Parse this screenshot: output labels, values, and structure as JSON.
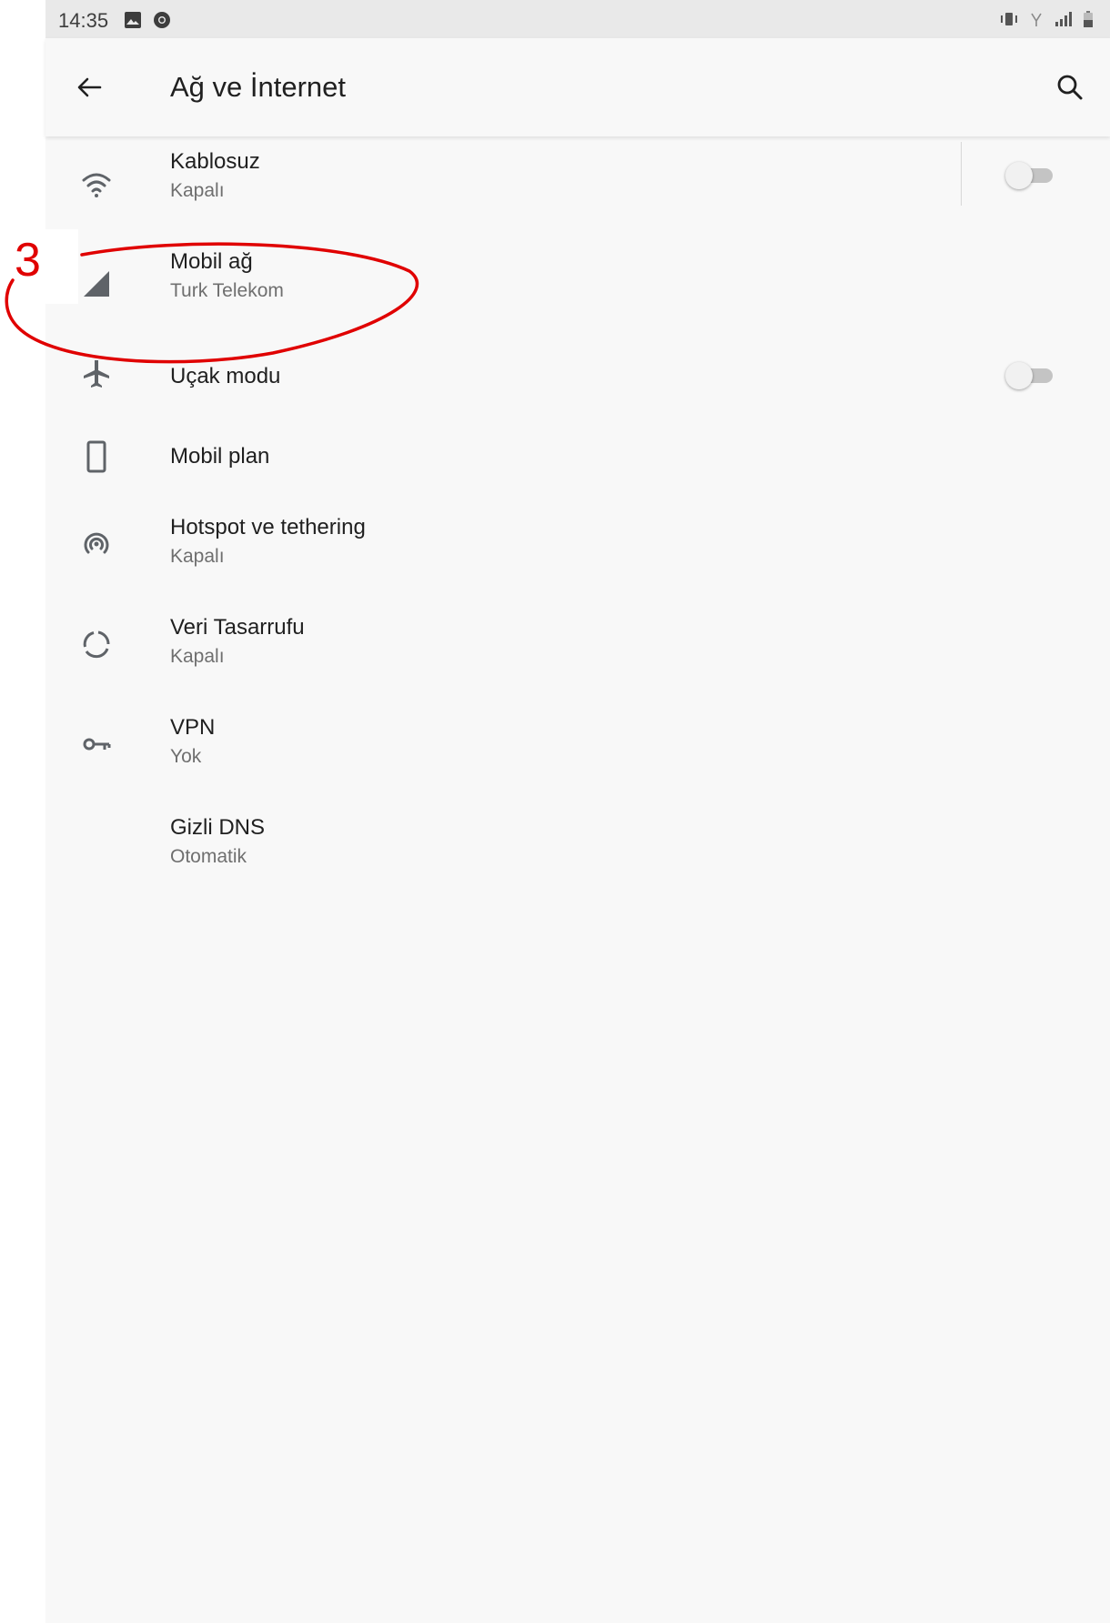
{
  "status_bar": {
    "time": "14:35",
    "left_icons": [
      "image-icon",
      "chrome-icon"
    ],
    "right_icons": [
      "vibrate-icon",
      "wifi-calling-icon",
      "signal-icon",
      "battery-icon"
    ]
  },
  "app_bar": {
    "title": "Ağ ve İnternet",
    "back_icon": "arrow-back-icon",
    "search_icon": "search-icon"
  },
  "items": [
    {
      "id": "wifi",
      "title": "Kablosuz",
      "subtitle": "Kapalı",
      "icon": "wifi-icon",
      "toggle": false
    },
    {
      "id": "mobile",
      "title": "Mobil ağ",
      "subtitle": "Turk Telekom",
      "icon": "cellular-signal-icon"
    },
    {
      "id": "airplane",
      "title": "Uçak modu",
      "subtitle": "",
      "icon": "airplane-icon",
      "toggle": false
    },
    {
      "id": "mobile-plan",
      "title": "Mobil plan",
      "subtitle": "",
      "icon": "phone-icon"
    },
    {
      "id": "hotspot",
      "title": "Hotspot ve tethering",
      "subtitle": "Kapalı",
      "icon": "hotspot-icon"
    },
    {
      "id": "data-saver",
      "title": "Veri Tasarrufu",
      "subtitle": "Kapalı",
      "icon": "data-saver-icon"
    },
    {
      "id": "vpn",
      "title": "VPN",
      "subtitle": "Yok",
      "icon": "key-icon"
    },
    {
      "id": "private-dns",
      "title": "Gizli DNS",
      "subtitle": "Otomatik",
      "icon": ""
    }
  ],
  "annotation": {
    "number": "3",
    "color": "#e00000"
  },
  "colors": {
    "background": "#f8f8f8",
    "status_bar": "#e9e9e9",
    "icon": "#5f6368",
    "toggle_track_off": "#c4c4c4"
  }
}
